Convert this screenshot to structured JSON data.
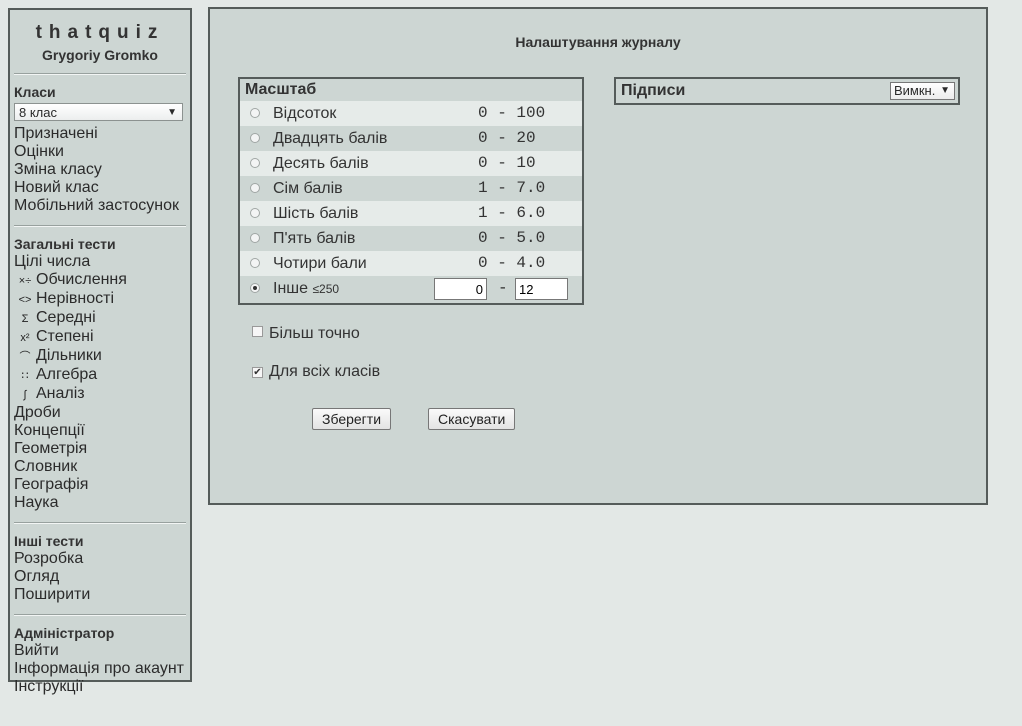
{
  "brand": {
    "name": "thatquiz",
    "user": "Grygoriy Gromko"
  },
  "sidebar": {
    "classes_title": "Класи",
    "class_select": "8 клас",
    "class_links": [
      "Призначені",
      "Оцінки",
      "Зміна класу",
      "Новий клас",
      "Мобільний застосунок"
    ],
    "general_title": "Загальні тести",
    "general_tests": [
      {
        "label": "Цілі числа",
        "icon": ""
      },
      {
        "label": "Обчислення",
        "icon": "arith-icon",
        "glyph": "×÷"
      },
      {
        "label": "Нерівності",
        "icon": "inequality-icon",
        "glyph": "<>"
      },
      {
        "label": "Середні",
        "icon": "mean-icon",
        "glyph": "Σ"
      },
      {
        "label": "Степені",
        "icon": "power-icon",
        "glyph": "x²"
      },
      {
        "label": "Дільники",
        "icon": "divisor-icon",
        "glyph": "⌒"
      },
      {
        "label": "Алгебра",
        "icon": "algebra-icon",
        "glyph": "∷"
      },
      {
        "label": "Аналіз",
        "icon": "integral-icon",
        "glyph": "∫"
      },
      {
        "label": "Дроби",
        "icon": ""
      },
      {
        "label": "Концепції",
        "icon": ""
      },
      {
        "label": "Геометрія",
        "icon": ""
      },
      {
        "label": "Словник",
        "icon": ""
      },
      {
        "label": "Географія",
        "icon": ""
      },
      {
        "label": "Наука",
        "icon": ""
      }
    ],
    "other_title": "Інші тести",
    "other_links": [
      "Розробка",
      "Огляд",
      "Поширити"
    ],
    "admin_title": "Адміністратор",
    "admin_links": [
      "Вийти",
      "Інформація про акаунт",
      "Інструкції"
    ]
  },
  "main": {
    "title": "Налаштування журналу",
    "scale_title": "Масштаб",
    "scale_rows": [
      {
        "label": "Відсоток",
        "range": "0 - 100",
        "selected": false
      },
      {
        "label": "Двадцять балів",
        "range": "0 - 20",
        "selected": false
      },
      {
        "label": "Десять балів",
        "range": "0 - 10",
        "selected": false
      },
      {
        "label": "Сім балів",
        "range": "1 - 7.0",
        "selected": false
      },
      {
        "label": "Шість балів",
        "range": "1 - 6.0",
        "selected": false
      },
      {
        "label": "П'ять балів",
        "range": "0 - 5.0",
        "selected": false
      },
      {
        "label": "Чотири бали",
        "range": "0 - 4.0",
        "selected": false
      }
    ],
    "custom": {
      "label": "Інше",
      "max_note": "≤250",
      "from": "0",
      "dash": "-",
      "to": "12",
      "selected": true
    },
    "signatures": {
      "title": "Підписи",
      "value": "Вимкн."
    },
    "more_precise": {
      "label": "Більш точно",
      "checked": false
    },
    "all_classes": {
      "label": "Для всіх класів",
      "checked": true
    },
    "save_label": "Зберегти",
    "cancel_label": "Скасувати"
  }
}
